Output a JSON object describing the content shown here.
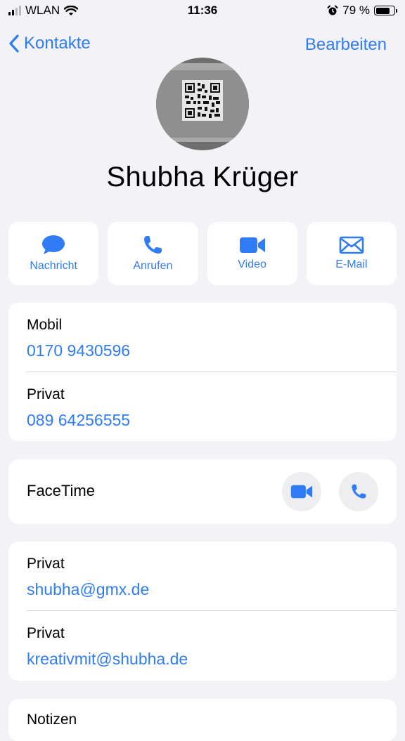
{
  "status_bar": {
    "carrier": "WLAN",
    "time": "11:36",
    "battery_percent": "79 %",
    "battery_level": 0.79
  },
  "nav": {
    "back_label": "Kontakte",
    "edit_label": "Bearbeiten"
  },
  "contact": {
    "name": "Shubha  Krüger"
  },
  "actions": [
    {
      "label": "Nachricht",
      "icon": "message-icon"
    },
    {
      "label": "Anrufen",
      "icon": "phone-icon"
    },
    {
      "label": "Video",
      "icon": "video-icon"
    },
    {
      "label": "E-Mail",
      "icon": "mail-icon"
    }
  ],
  "phones": [
    {
      "label": "Mobil",
      "value": "0170 9430596"
    },
    {
      "label": "Privat",
      "value": "089 64256555"
    }
  ],
  "facetime": {
    "label": "FaceTime"
  },
  "emails": [
    {
      "label": "Privat",
      "value": "shubha@gmx.de"
    },
    {
      "label": "Privat",
      "value": "kreativmit@shubha.de"
    }
  ],
  "notes": {
    "label": "Notizen"
  },
  "colors": {
    "accent": "#2f7cf6",
    "background": "#f2f2f7",
    "card": "#ffffff"
  }
}
